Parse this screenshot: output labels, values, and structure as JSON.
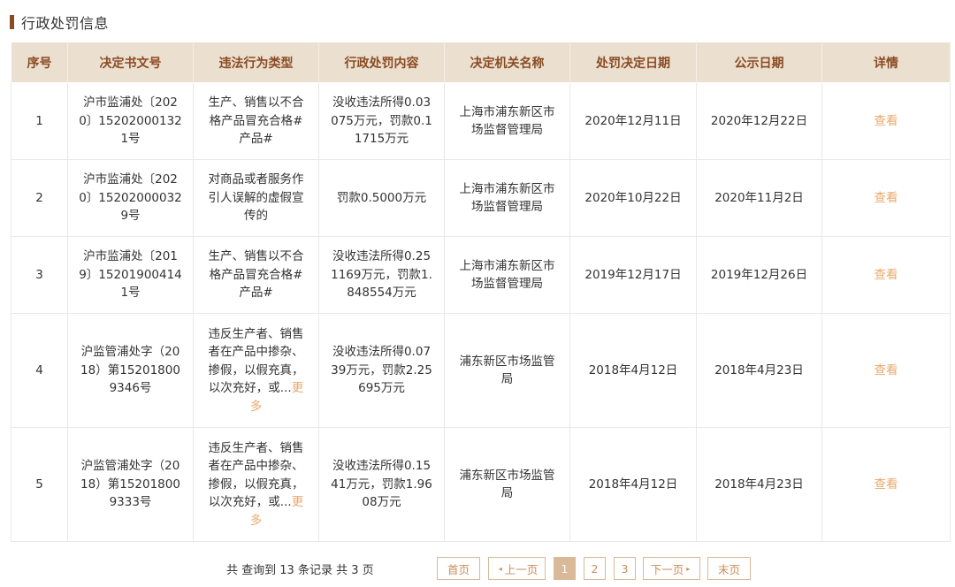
{
  "section": {
    "title": "行政处罚信息"
  },
  "table": {
    "headers": [
      "序号",
      "决定书文号",
      "违法行为类型",
      "行政处罚内容",
      "决定机关名称",
      "处罚决定日期",
      "公示日期",
      "详情"
    ],
    "rows": [
      {
        "no": "1",
        "doc": "沪市监浦处〔2020〕152020001321号",
        "type": "生产、销售以不合格产品冒充合格#产品#",
        "more": "",
        "content": "没收违法所得0.03075万元，罚款0.11715万元",
        "org": "上海市浦东新区市场监督管理局",
        "decision_date": "2020年12月11日",
        "publish_date": "2020年12月22日",
        "detail": "查看"
      },
      {
        "no": "2",
        "doc": "沪市监浦处〔2020〕152020000329号",
        "type": "对商品或者服务作引人误解的虚假宣传的",
        "more": "",
        "content": "罚款0.5000万元",
        "org": "上海市浦东新区市场监督管理局",
        "decision_date": "2020年10月22日",
        "publish_date": "2020年11月2日",
        "detail": "查看"
      },
      {
        "no": "3",
        "doc": "沪市监浦处〔2019〕152019004141号",
        "type": "生产、销售以不合格产品冒充合格#产品#",
        "more": "",
        "content": "没收违法所得0.251169万元，罚款1.848554万元",
        "org": "上海市浦东新区市场监督管理局",
        "decision_date": "2019年12月17日",
        "publish_date": "2019年12月26日",
        "detail": "查看"
      },
      {
        "no": "4",
        "doc": "沪监管浦处字（2018）第152018009346号",
        "type": "违反生产者、销售者在产品中掺杂、掺假，以假充真，以次充好，或...",
        "more": "更多",
        "content": "没收违法所得0.0739万元，罚款2.25695万元",
        "org": "浦东新区市场监管局",
        "decision_date": "2018年4月12日",
        "publish_date": "2018年4月23日",
        "detail": "查看"
      },
      {
        "no": "5",
        "doc": "沪监管浦处字（2018）第152018009333号",
        "type": "违反生产者、销售者在产品中掺杂、掺假，以假充真，以次充好，或...",
        "more": "更多",
        "content": "没收违法所得0.1541万元，罚款1.9608万元",
        "org": "浦东新区市场监管局",
        "decision_date": "2018年4月12日",
        "publish_date": "2018年4月23日",
        "detail": "查看"
      }
    ]
  },
  "pagination": {
    "summary": "共 查询到 13 条记录 共 3 页",
    "first": "首页",
    "prev": "上一页",
    "pages": [
      "1",
      "2",
      "3"
    ],
    "current": "1",
    "next": "下一页",
    "last": "末页"
  },
  "colors": {
    "header_bg": "#ebdfcf",
    "header_text": "#8a4b23",
    "link": "#e8a96c",
    "pager_border": "#d9b998",
    "title_bar": "#8a4b23"
  }
}
